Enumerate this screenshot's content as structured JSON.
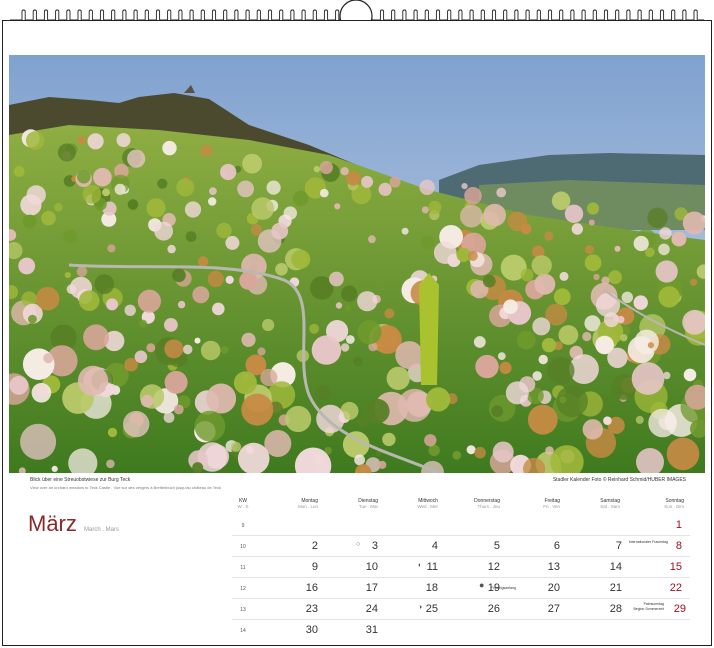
{
  "caption": {
    "title": "Blick über eine Streuobstwiese zur Burg Teck",
    "subtitle": "View over an orchard meadow to Teck Castle . Vue sur des vergers à Breitenbuch jusqu'au château de Teck",
    "credit": "Stadler Kalender Foto © Reinhard Schmid/HUBER IMAGES"
  },
  "calendar": {
    "month": "März",
    "month_sub": "March . Mars",
    "kw_header": "KW",
    "kw_sub": "W . S",
    "weekdays": [
      {
        "name": "Montag",
        "sub": "Mon . Lun"
      },
      {
        "name": "Dienstag",
        "sub": "Tue . Mar"
      },
      {
        "name": "Mittwoch",
        "sub": "Wed . Mer"
      },
      {
        "name": "Donnerstag",
        "sub": "Thurs . Jeu"
      },
      {
        "name": "Freitag",
        "sub": "Fri . Ven"
      },
      {
        "name": "Samstag",
        "sub": "Sat . Sam"
      },
      {
        "name": "Sonntag",
        "sub": "Sun . Dim"
      }
    ],
    "weeks": [
      {
        "kw": "9",
        "days": [
          "",
          "",
          "",
          "",
          "",
          "",
          "1"
        ]
      },
      {
        "kw": "10",
        "days": [
          "2",
          "3",
          "4",
          "5",
          "6",
          "7",
          "8"
        ]
      },
      {
        "kw": "11",
        "days": [
          "9",
          "10",
          "11",
          "12",
          "13",
          "14",
          "15"
        ]
      },
      {
        "kw": "12",
        "days": [
          "16",
          "17",
          "18",
          "19",
          "20",
          "21",
          "22"
        ]
      },
      {
        "kw": "13",
        "days": [
          "23",
          "24",
          "25",
          "26",
          "27",
          "28",
          "29"
        ]
      },
      {
        "kw": "14",
        "days": [
          "30",
          "31",
          "",
          "",
          "",
          "",
          ""
        ]
      }
    ],
    "notes": {
      "womens_day": "Internationaler Frauentag",
      "spring": "Frühlingsanfang",
      "palm_sunday_1": "Palmsonntag",
      "palm_sunday_2": "Beginn Sommerzeit"
    }
  },
  "colors": {
    "accent": "#8a2a2a",
    "sunday": "#a01020"
  }
}
